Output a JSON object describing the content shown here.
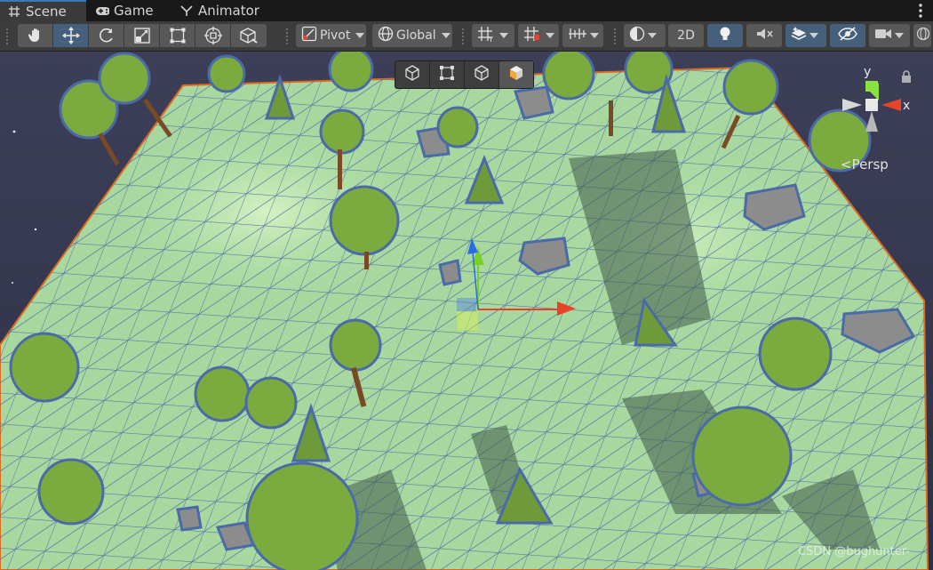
{
  "tabs": [
    {
      "label": "Scene",
      "icon": "scene-grid-icon",
      "active": true
    },
    {
      "label": "Game",
      "icon": "gamepad-icon",
      "active": false
    },
    {
      "label": "Animator",
      "icon": "animator-icon",
      "active": false
    }
  ],
  "toolbar": {
    "transform_tools": [
      {
        "name": "hand-tool",
        "icon": "hand-icon",
        "active": false
      },
      {
        "name": "move-tool",
        "icon": "move-arrows-icon",
        "active": true
      },
      {
        "name": "rotate-tool",
        "icon": "rotate-icon",
        "active": false
      },
      {
        "name": "scale-tool",
        "icon": "scale-icon",
        "active": false
      },
      {
        "name": "rect-tool",
        "icon": "rect-transform-icon",
        "active": false
      },
      {
        "name": "transform-tool",
        "icon": "transform-icon",
        "active": false
      },
      {
        "name": "custom-tool",
        "icon": "custom-tool-icon",
        "active": false
      }
    ],
    "pivot_label": "Pivot",
    "global_label": "Global",
    "mode_2d_label": "2D"
  },
  "overlay_tools": [
    {
      "icon": "cube-wire-icon",
      "selected": false
    },
    {
      "icon": "rect-select-icon",
      "selected": false
    },
    {
      "icon": "cube-outline-icon",
      "selected": false
    },
    {
      "icon": "cube-orange-face-icon",
      "selected": true
    }
  ],
  "gizmo": {
    "y_label": "y",
    "x_label": "x",
    "projection_label": "<Persp"
  },
  "watermark": "CSDN @bughunter-",
  "colors": {
    "accent": "#3a79bb",
    "terrain": "#a8d8a0",
    "wire": "#4a6aa8",
    "selection_outline": "#e06a1a",
    "axis_x": "#e8432a",
    "axis_y": "#7ad02a",
    "axis_z": "#2a6ce8"
  }
}
